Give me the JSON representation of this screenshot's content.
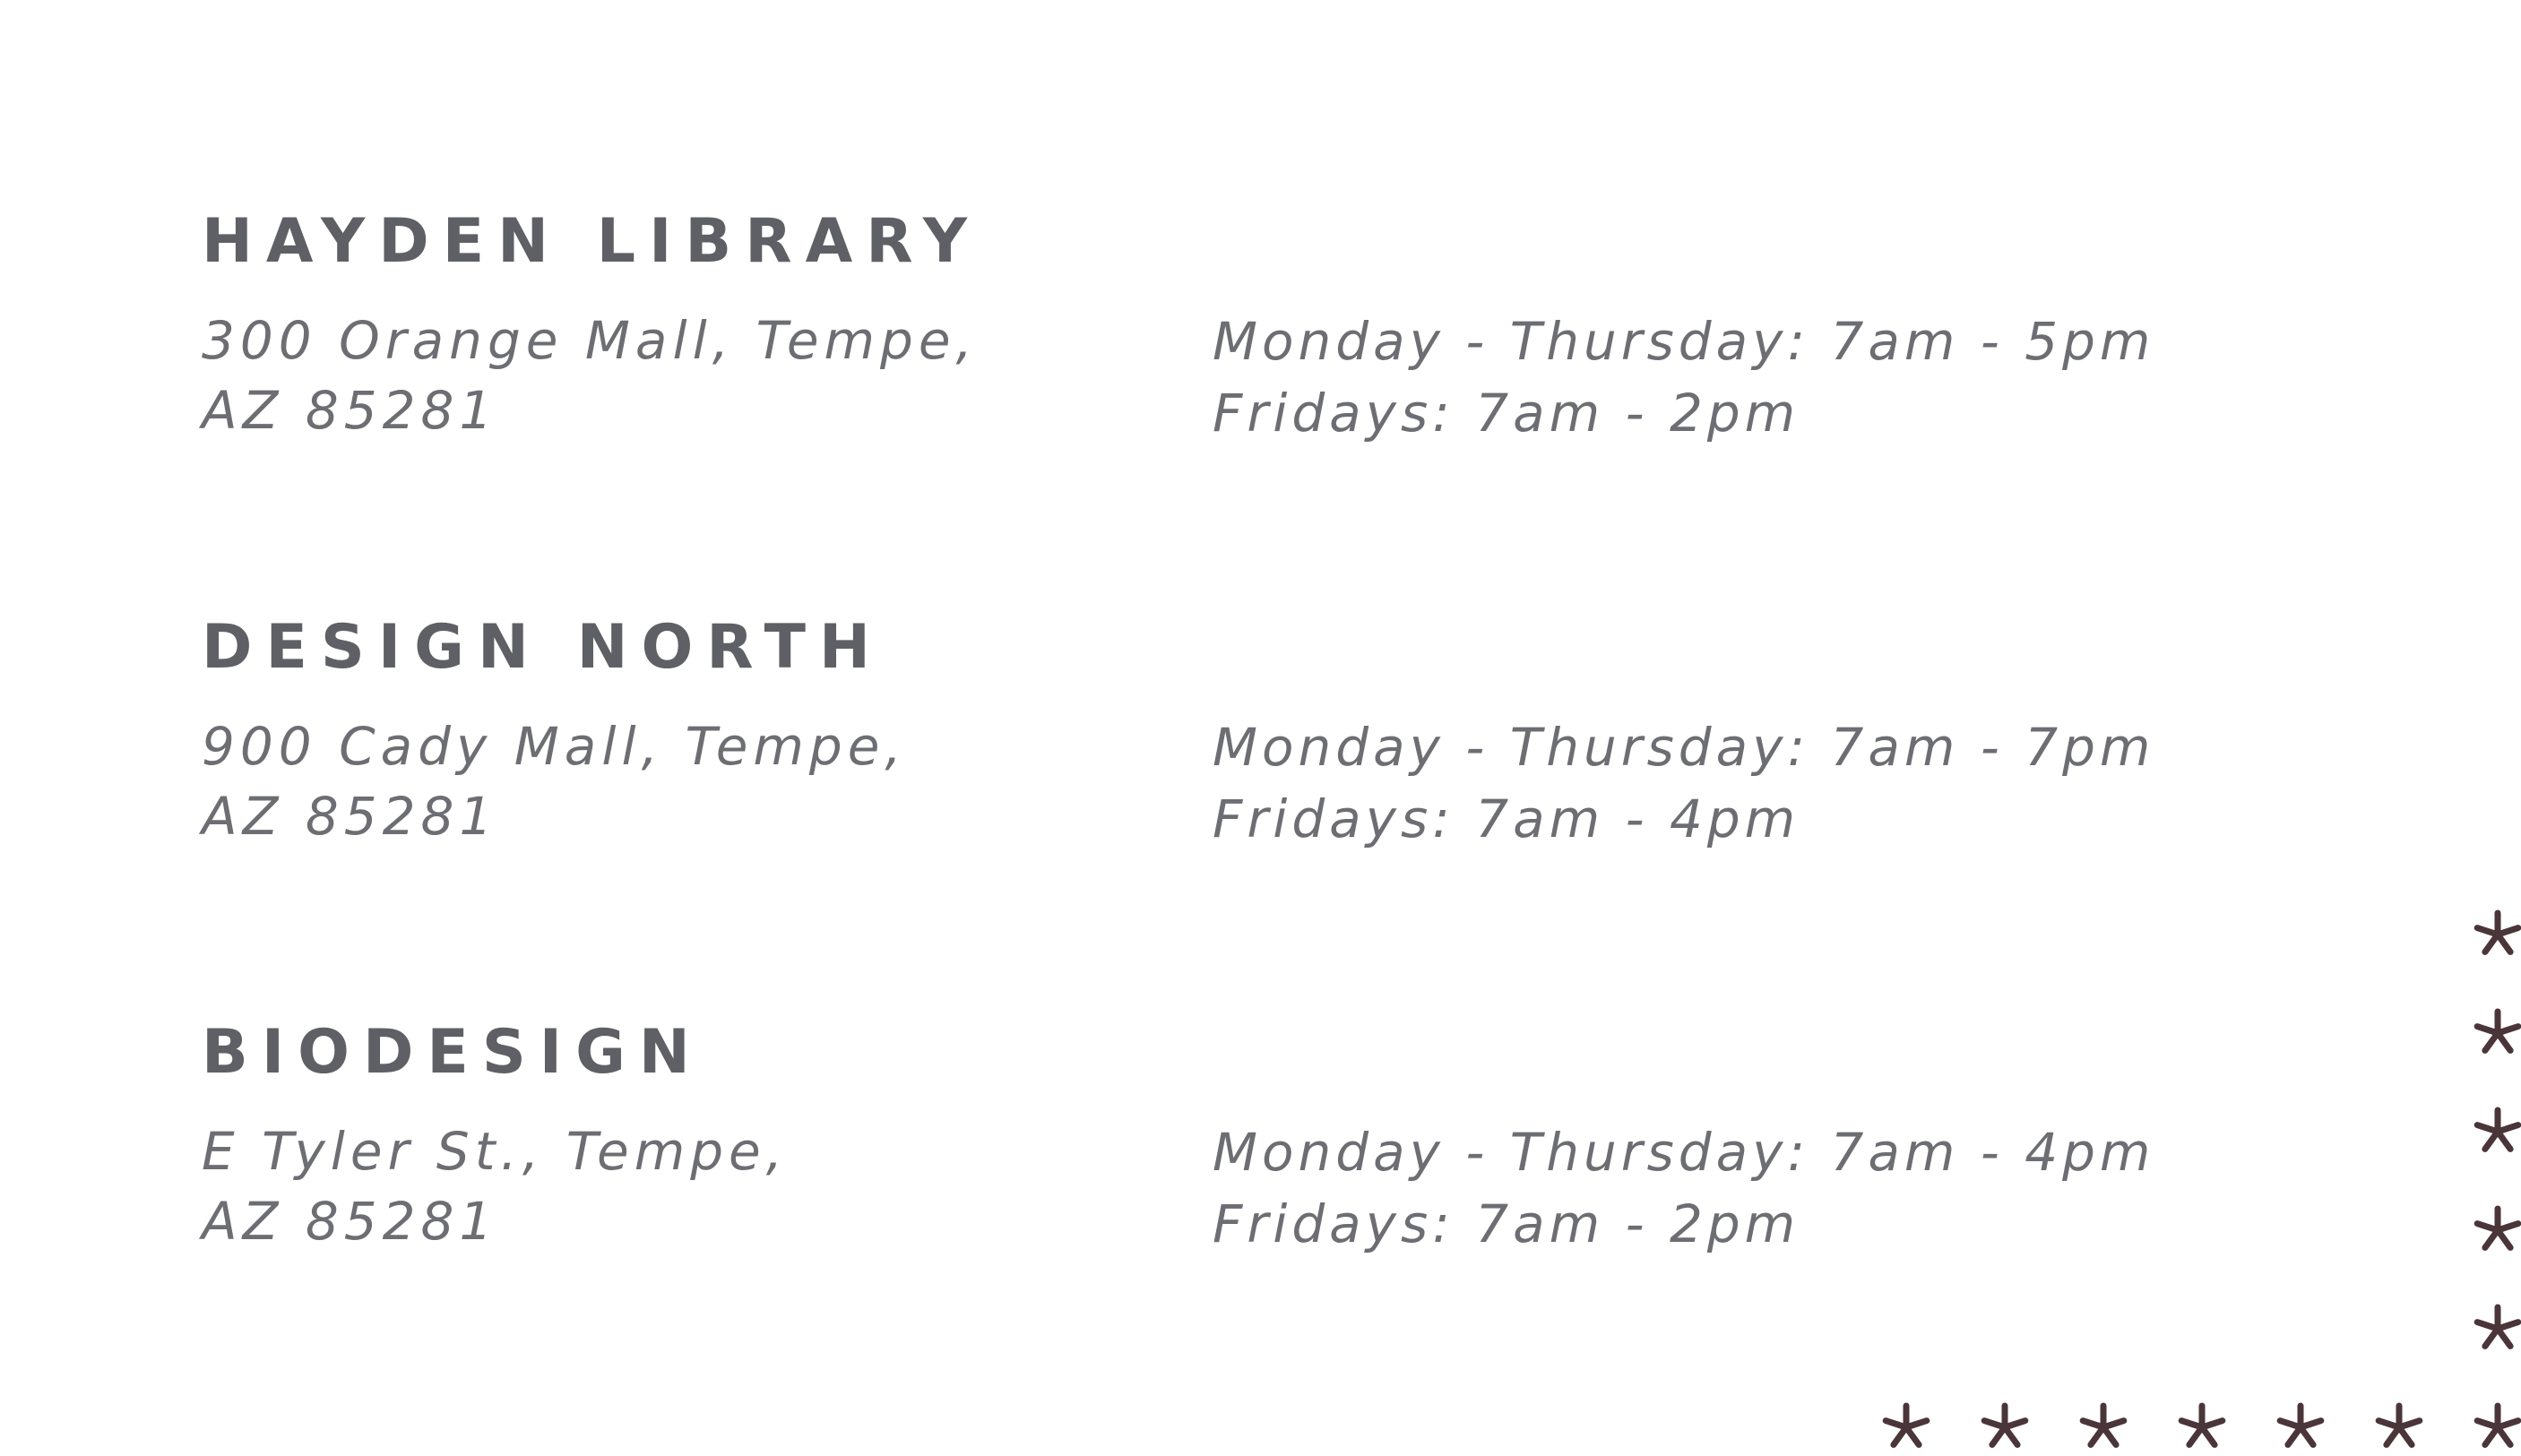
{
  "locations": [
    {
      "name": "HAYDEN LIBRARY",
      "address_line1": "300 Orange Mall, Tempe,",
      "address_line2": "AZ 85281",
      "hours_line1": "Monday - Thursday: 7am - 5pm",
      "hours_line2": "Fridays: 7am - 2pm"
    },
    {
      "name": "DESIGN NORTH",
      "address_line1": "900 Cady Mall, Tempe,",
      "address_line2": "AZ 85281",
      "hours_line1": "Monday - Thursday: 7am - 7pm",
      "hours_line2": "Fridays: 7am - 4pm"
    },
    {
      "name": "BIODESIGN",
      "address_line1": "E Tyler St., Tempe,",
      "address_line2": "AZ 85281",
      "hours_line1": "Monday - Thursday: 7am - 4pm",
      "hours_line2": "Fridays: 7am - 2pm"
    }
  ],
  "colors": {
    "heading": "#5f6065",
    "body_text": "#6d6e73",
    "asterisk": "#4a3538",
    "background": "#ffffff"
  },
  "decoration": {
    "icon": "asterisk-icon",
    "vertical_count": 6,
    "horizontal_count": 7
  }
}
